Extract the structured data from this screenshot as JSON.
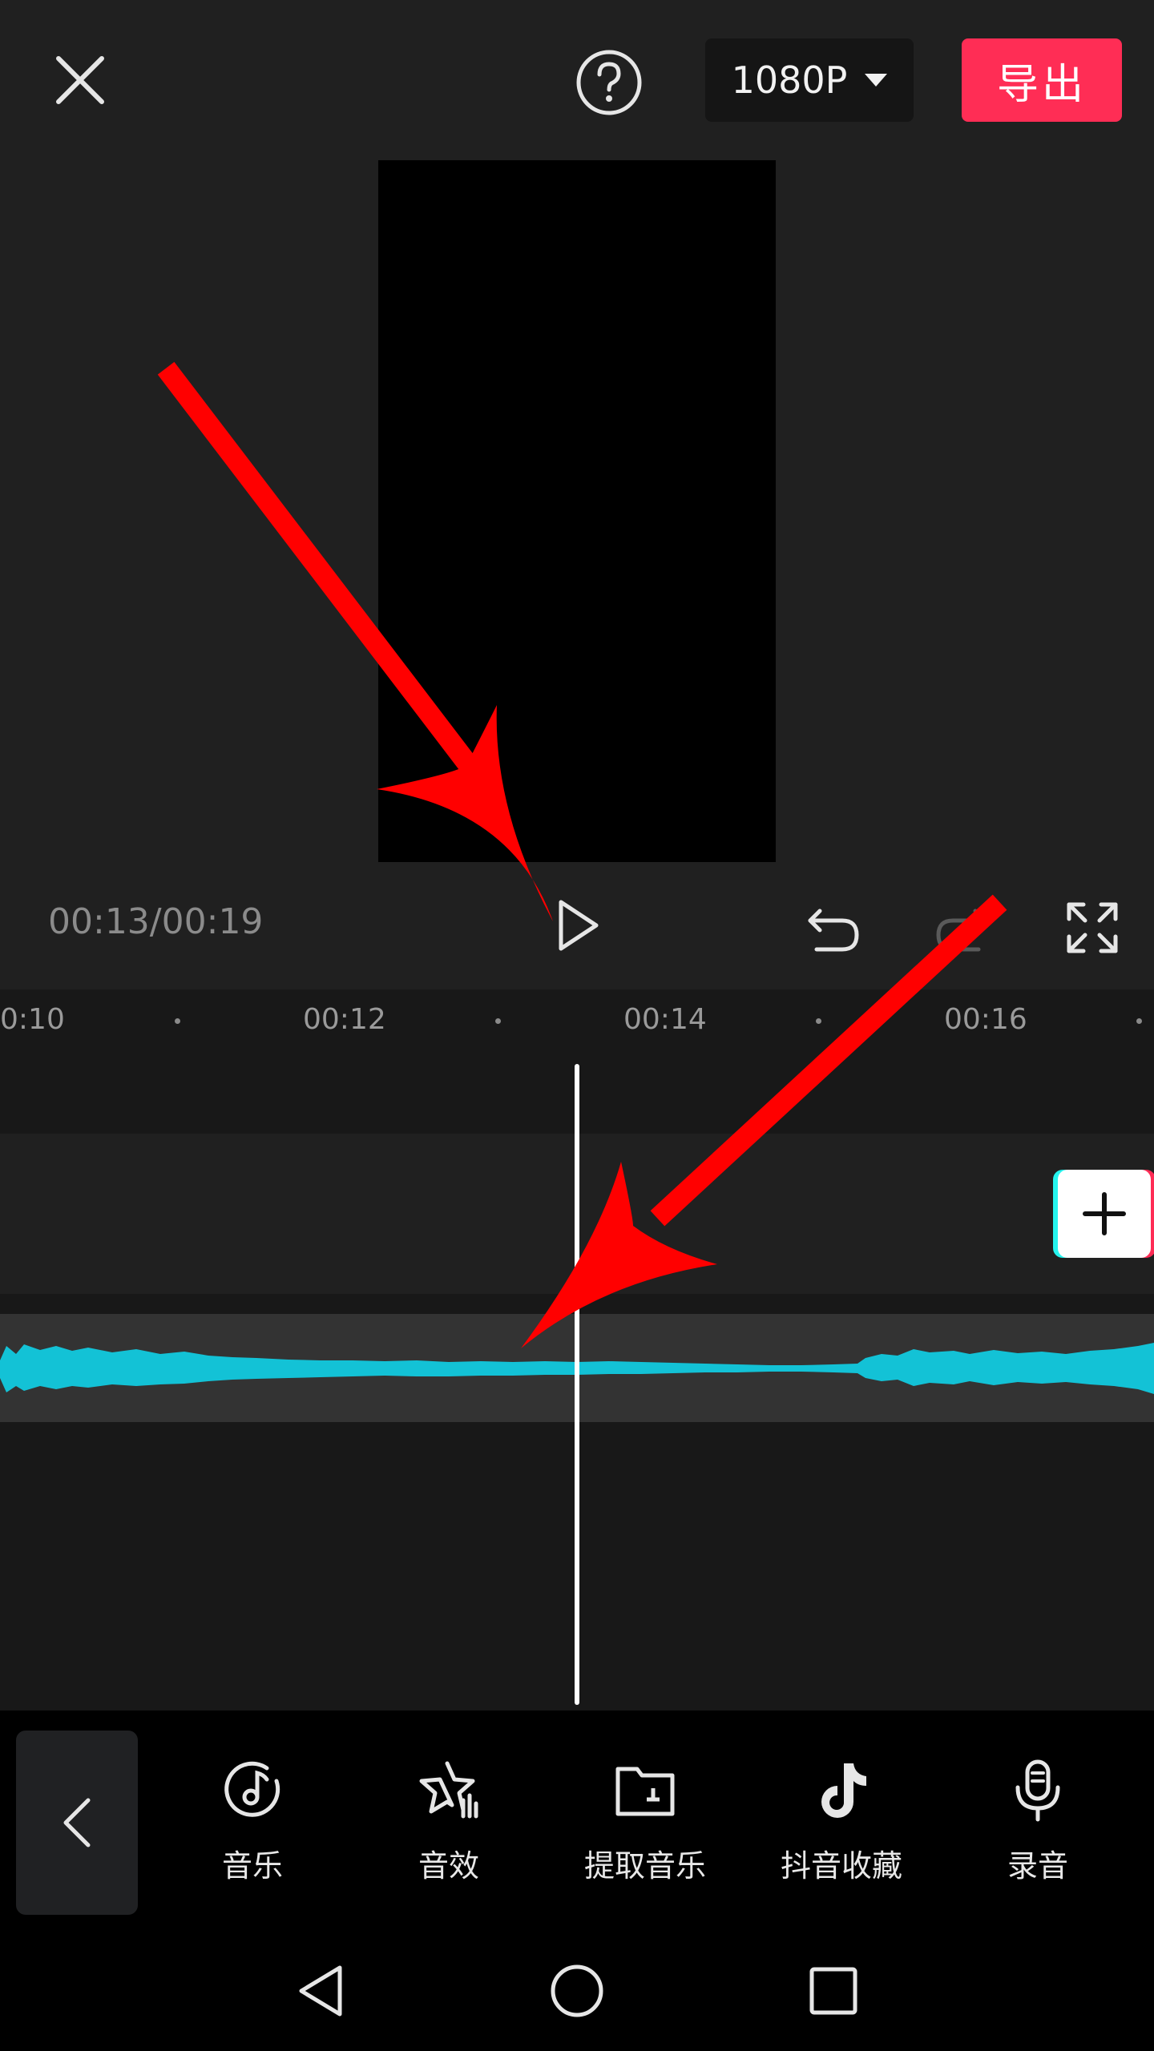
{
  "header": {
    "resolution": "1080P",
    "export_label": "导出"
  },
  "player": {
    "timecode": "00:13/00:19"
  },
  "timeline": {
    "ticks": [
      "0:10",
      "00:12",
      "00:14",
      "00:16"
    ]
  },
  "toolbar": {
    "items": [
      {
        "label": "音乐",
        "icon": "music-disc-icon"
      },
      {
        "label": "音效",
        "icon": "sound-effect-star-icon"
      },
      {
        "label": "提取音乐",
        "icon": "folder-extract-icon"
      },
      {
        "label": "抖音收藏",
        "icon": "douyin-logo-icon"
      },
      {
        "label": "录音",
        "icon": "microphone-icon"
      }
    ]
  },
  "colors": {
    "export": "#ff2d55",
    "waveform": "#13c2d6",
    "annotation_arrow": "#ff0000"
  }
}
